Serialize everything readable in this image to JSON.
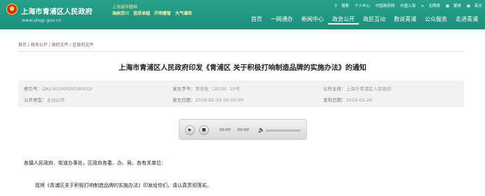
{
  "header": {
    "site_name": "上海市青浦区人民政府",
    "site_url": "www.shqp.gov.cn",
    "brand_top": "上海城市精神",
    "brand_links": [
      "海纳百川",
      "追求卓越",
      "开明睿智",
      "大气谦和"
    ],
    "toplinks": [
      "搜索",
      "个人中心",
      "中国政府网",
      "中国上海",
      "无障碍",
      "繁体",
      "英文"
    ],
    "nav": [
      "首页",
      "一网通办",
      "新闻中心",
      "政务公开",
      "政民互动",
      "数说青浦",
      "公众服务",
      "走进青浦"
    ],
    "active_nav": "政务公开"
  },
  "breadcrumb": "首页 / 政务公开 / 政府文件 / 区政府文件",
  "article": {
    "title": "上海市青浦区人民政府印发《青浦区 关于积极打响制造品牌的实施办法》的通知",
    "meta": {
      "index_label": "索引号：",
      "index_value": "QA130100020180010",
      "doc_no_label": "发文字号：",
      "doc_no_value": "青府发〔2019〕10号",
      "subject_label": "公开主体：",
      "subject_value": "上海市青浦区人民政府",
      "type_label": "公开类型：",
      "type_value": "主动公开",
      "date_label": "发文日期：",
      "date_value": "2019-02-20 00:00:00",
      "pub_label": "发布日期：",
      "pub_value": "2019-02-20"
    },
    "player": {
      "current": "00:00",
      "duration": "00:00"
    },
    "p1": "各镇人民政府、街道办事处，区政府各委、办、局，各有关单位：",
    "p2": "现将《青浦区关于积极打响制造品牌的实施办法》印发给你们，请认真贯彻落实。"
  }
}
